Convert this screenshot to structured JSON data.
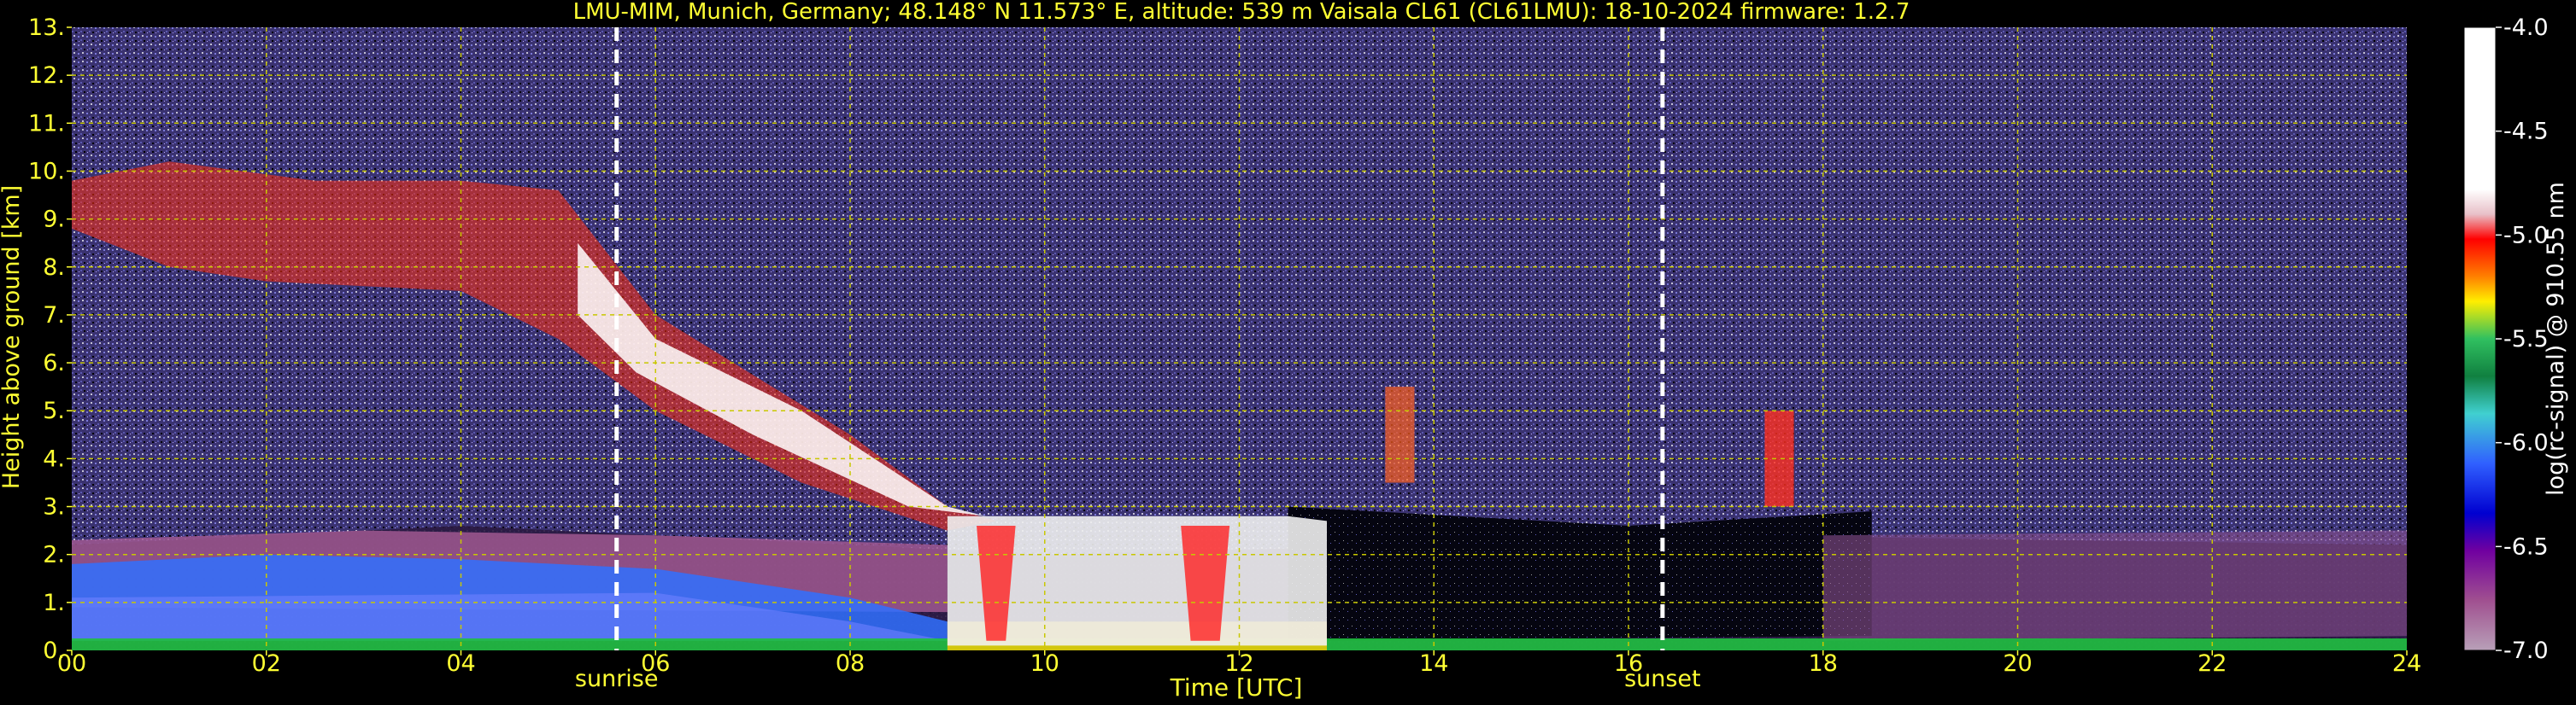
{
  "chart_data": {
    "type": "heatmap",
    "title": "LMU-MIM, Munich, Germany; 48.148° N 11.573° E, altitude: 539 m    Vaisala CL61 (CL61LMU): 18-10-2024    firmware: 1.2.7",
    "xlabel": "Time [UTC]",
    "ylabel": "Height above ground [km]",
    "xlim": [
      0,
      24
    ],
    "ylim": [
      0,
      13
    ],
    "x_ticks": [
      "00",
      "02",
      "04",
      "06",
      "08",
      "10",
      "12",
      "14",
      "16",
      "18",
      "20",
      "22",
      "24"
    ],
    "y_ticks": [
      "0.",
      "1.",
      "2.",
      "3.",
      "4.",
      "5.",
      "6.",
      "7.",
      "8.",
      "9.",
      "10.",
      "11.",
      "12.",
      "13."
    ],
    "grid": true,
    "colorbar": {
      "label": "log(rc-signal) @ 910.55 nm",
      "range": [
        -7.0,
        -4.0
      ],
      "ticks": [
        "-4.0",
        "-4.5",
        "-5.0",
        "-5.5",
        "-6.0",
        "-6.5",
        "-7.0"
      ]
    },
    "annotations": [
      {
        "text": "sunrise",
        "x": 5.6
      },
      {
        "text": "sunset",
        "x": 16.35
      }
    ],
    "colors": {
      "background": "#000000",
      "text": "#ffff33",
      "grid": "#c8c800",
      "marker_lines": "#ffffff"
    }
  }
}
